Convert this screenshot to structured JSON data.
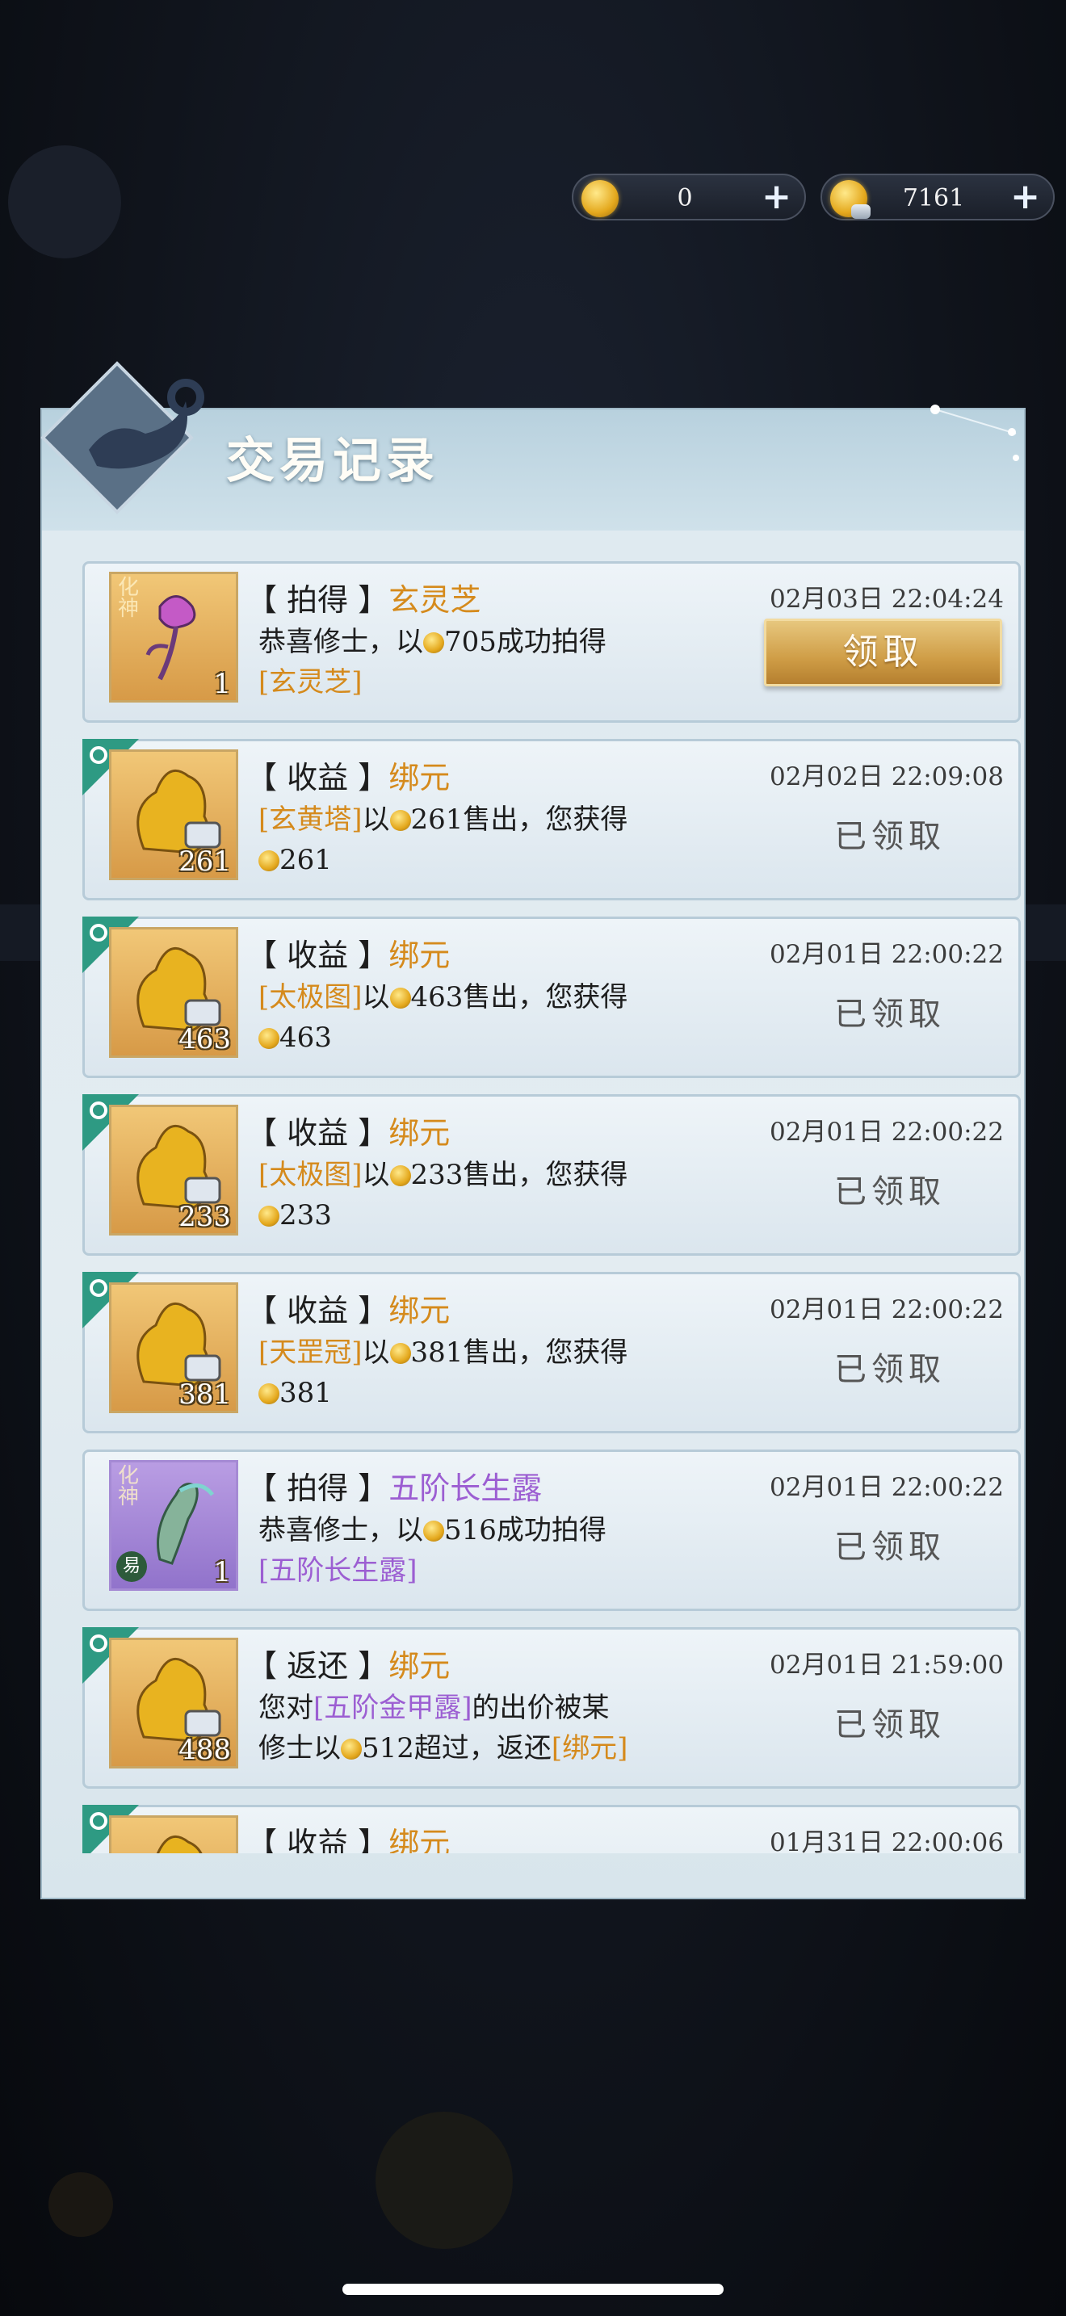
{
  "currency": [
    {
      "icon": "gold-lotus-coin-icon",
      "value": "0",
      "plus": "+"
    },
    {
      "icon": "gold-lotus-ingot-icon",
      "value": "7161",
      "plus": "+"
    }
  ],
  "panel": {
    "title": "交易记录"
  },
  "records": [
    {
      "type": "拍得",
      "name": "玄灵芝",
      "name_color": "orange",
      "time": "02月03日 22:04:24",
      "desc_parts": [
        {
          "t": "恭喜修士，以"
        },
        {
          "coin": true
        },
        {
          "t": "705成功拍得"
        },
        {
          "br": true
        },
        {
          "t": "[玄灵芝]",
          "c": "or"
        }
      ],
      "item": {
        "icon": "purple-flower-icon",
        "qty": "1",
        "frame": "gold",
        "tag": "化\n神"
      },
      "action": "button",
      "action_label": "领取"
    },
    {
      "type": "收益",
      "name": "绑元",
      "name_color": "orange",
      "time": "02月02日 22:09:08",
      "desc_parts": [
        {
          "t": "[玄黄塔]",
          "c": "or"
        },
        {
          "t": "以"
        },
        {
          "coin": true
        },
        {
          "t": "261售出，您获得"
        },
        {
          "br": true
        },
        {
          "coin": true
        },
        {
          "t": "261"
        }
      ],
      "item": {
        "icon": "gold-lotus-ingot-icon",
        "qty": "261",
        "frame": "gold"
      },
      "action": "claimed",
      "action_label": "已领取"
    },
    {
      "type": "收益",
      "name": "绑元",
      "name_color": "orange",
      "time": "02月01日 22:00:22",
      "desc_parts": [
        {
          "t": "[太极图]",
          "c": "or"
        },
        {
          "t": "以"
        },
        {
          "coin": true
        },
        {
          "t": "463售出，您获得"
        },
        {
          "br": true
        },
        {
          "coin": true
        },
        {
          "t": "463"
        }
      ],
      "item": {
        "icon": "gold-lotus-ingot-icon",
        "qty": "463",
        "frame": "gold"
      },
      "action": "claimed",
      "action_label": "已领取"
    },
    {
      "type": "收益",
      "name": "绑元",
      "name_color": "orange",
      "time": "02月01日 22:00:22",
      "desc_parts": [
        {
          "t": "[太极图]",
          "c": "or"
        },
        {
          "t": "以"
        },
        {
          "coin": true
        },
        {
          "t": "233售出，您获得"
        },
        {
          "br": true
        },
        {
          "coin": true
        },
        {
          "t": "233"
        }
      ],
      "item": {
        "icon": "gold-lotus-ingot-icon",
        "qty": "233",
        "frame": "gold"
      },
      "action": "claimed",
      "action_label": "已领取"
    },
    {
      "type": "收益",
      "name": "绑元",
      "name_color": "orange",
      "time": "02月01日 22:00:22",
      "desc_parts": [
        {
          "t": "[天罡冠]",
          "c": "or"
        },
        {
          "t": "以"
        },
        {
          "coin": true
        },
        {
          "t": "381售出，您获得"
        },
        {
          "br": true
        },
        {
          "coin": true
        },
        {
          "t": "381"
        }
      ],
      "item": {
        "icon": "gold-lotus-ingot-icon",
        "qty": "381",
        "frame": "gold"
      },
      "action": "claimed",
      "action_label": "已领取"
    },
    {
      "type": "拍得",
      "name": "五阶长生露",
      "name_color": "purple",
      "time": "02月01日 22:00:22",
      "desc_parts": [
        {
          "t": "恭喜修士，以"
        },
        {
          "coin": true
        },
        {
          "t": "516成功拍得"
        },
        {
          "br": true
        },
        {
          "t": "[五阶长生露]",
          "c": "pu"
        }
      ],
      "item": {
        "icon": "jade-vase-icon",
        "qty": "1",
        "frame": "purple",
        "tag": "化\n神",
        "sub": "易"
      },
      "action": "claimed",
      "action_label": "已领取"
    },
    {
      "type": "返还",
      "name": "绑元",
      "name_color": "orange",
      "time": "02月01日 21:59:00",
      "desc_parts": [
        {
          "t": "您对"
        },
        {
          "t": "[五阶金甲露]",
          "c": "pu"
        },
        {
          "t": "的出价被某"
        },
        {
          "br": true
        },
        {
          "t": "修士以"
        },
        {
          "coin": true
        },
        {
          "t": "512超过，返还"
        },
        {
          "t": "[绑元]",
          "c": "or"
        }
      ],
      "item": {
        "icon": "gold-lotus-ingot-icon",
        "qty": "488",
        "frame": "gold"
      },
      "action": "claimed",
      "action_label": "已领取"
    },
    {
      "type": "收益",
      "name": "绑元",
      "name_color": "orange",
      "time": "01月31日 22:00:06",
      "desc_parts": [],
      "item": {
        "icon": "gold-lotus-ingot-icon",
        "qty": "",
        "frame": "gold"
      },
      "action": "none",
      "action_label": ""
    }
  ],
  "colors": {
    "accent_orange": "#d58a1c",
    "accent_purple": "#9c5ed2",
    "button_gold": "#cf9d46"
  }
}
